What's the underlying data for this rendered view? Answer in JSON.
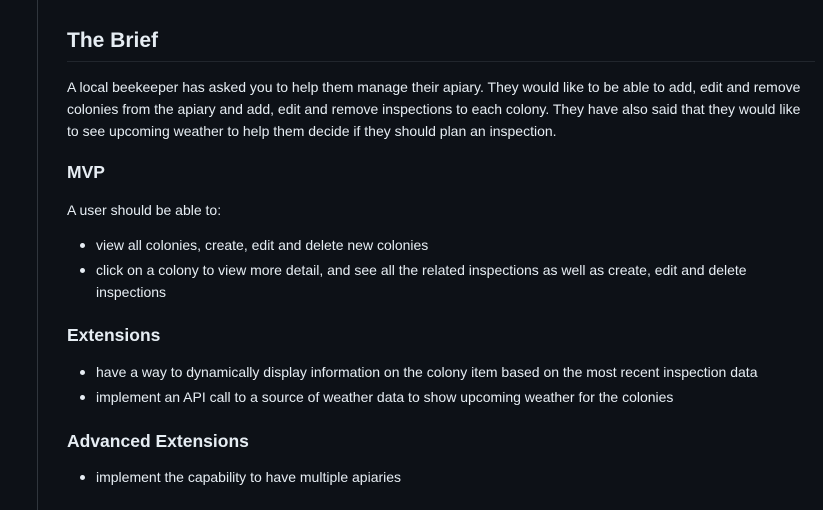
{
  "title": "The Brief",
  "intro": "A local beekeeper has asked you to help them manage their apiary. They would like to be able to add, edit and remove colonies from the apiary and add, edit and remove inspections to each colony. They have also said that they would like to see upcoming weather to help them decide if they should plan an inspection.",
  "mvp": {
    "heading": "MVP",
    "lead": "A user should be able to:",
    "items": [
      "view all colonies, create, edit and delete new colonies",
      "click on a colony to view more detail, and see all the related inspections as well as create, edit and delete inspections"
    ]
  },
  "extensions": {
    "heading": "Extensions",
    "items": [
      "have a way to dynamically display information on the colony item based on the most recent inspection data",
      "implement an API call to a source of weather data to show upcoming weather for the colonies"
    ]
  },
  "advanced": {
    "heading": "Advanced Extensions",
    "items": [
      "implement the capability to have multiple apiaries"
    ]
  }
}
